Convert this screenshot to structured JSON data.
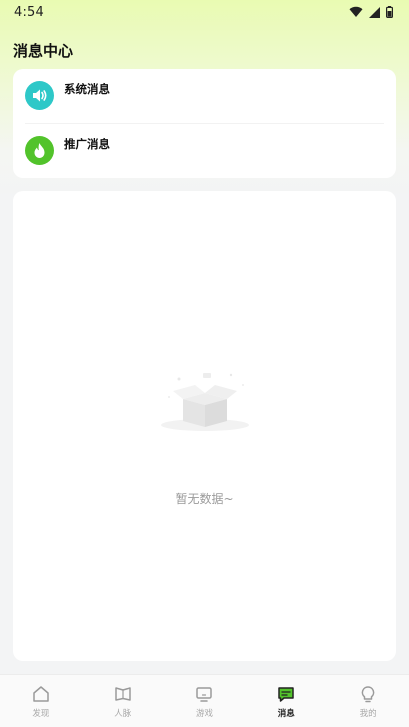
{
  "status_bar": {
    "time": "4:54"
  },
  "page": {
    "title": "消息中心"
  },
  "messages": {
    "items": [
      {
        "label": "系统消息",
        "icon": "speaker-icon",
        "color": "#2ec8c8"
      },
      {
        "label": "推广消息",
        "icon": "flame-icon",
        "color": "#52c32b"
      }
    ]
  },
  "empty_state": {
    "text": "暂无数据~"
  },
  "tab_bar": {
    "items": [
      {
        "label": "发现",
        "icon": "home-icon",
        "active": false
      },
      {
        "label": "人脉",
        "icon": "book-icon",
        "active": false
      },
      {
        "label": "游戏",
        "icon": "monitor-icon",
        "active": false
      },
      {
        "label": "消息",
        "icon": "message-icon",
        "active": true
      },
      {
        "label": "我的",
        "icon": "bulb-icon",
        "active": false
      }
    ]
  },
  "colors": {
    "accent_green": "#52c32b",
    "accent_teal": "#2ec8c8",
    "header_gradient": "#e9fbb2"
  }
}
